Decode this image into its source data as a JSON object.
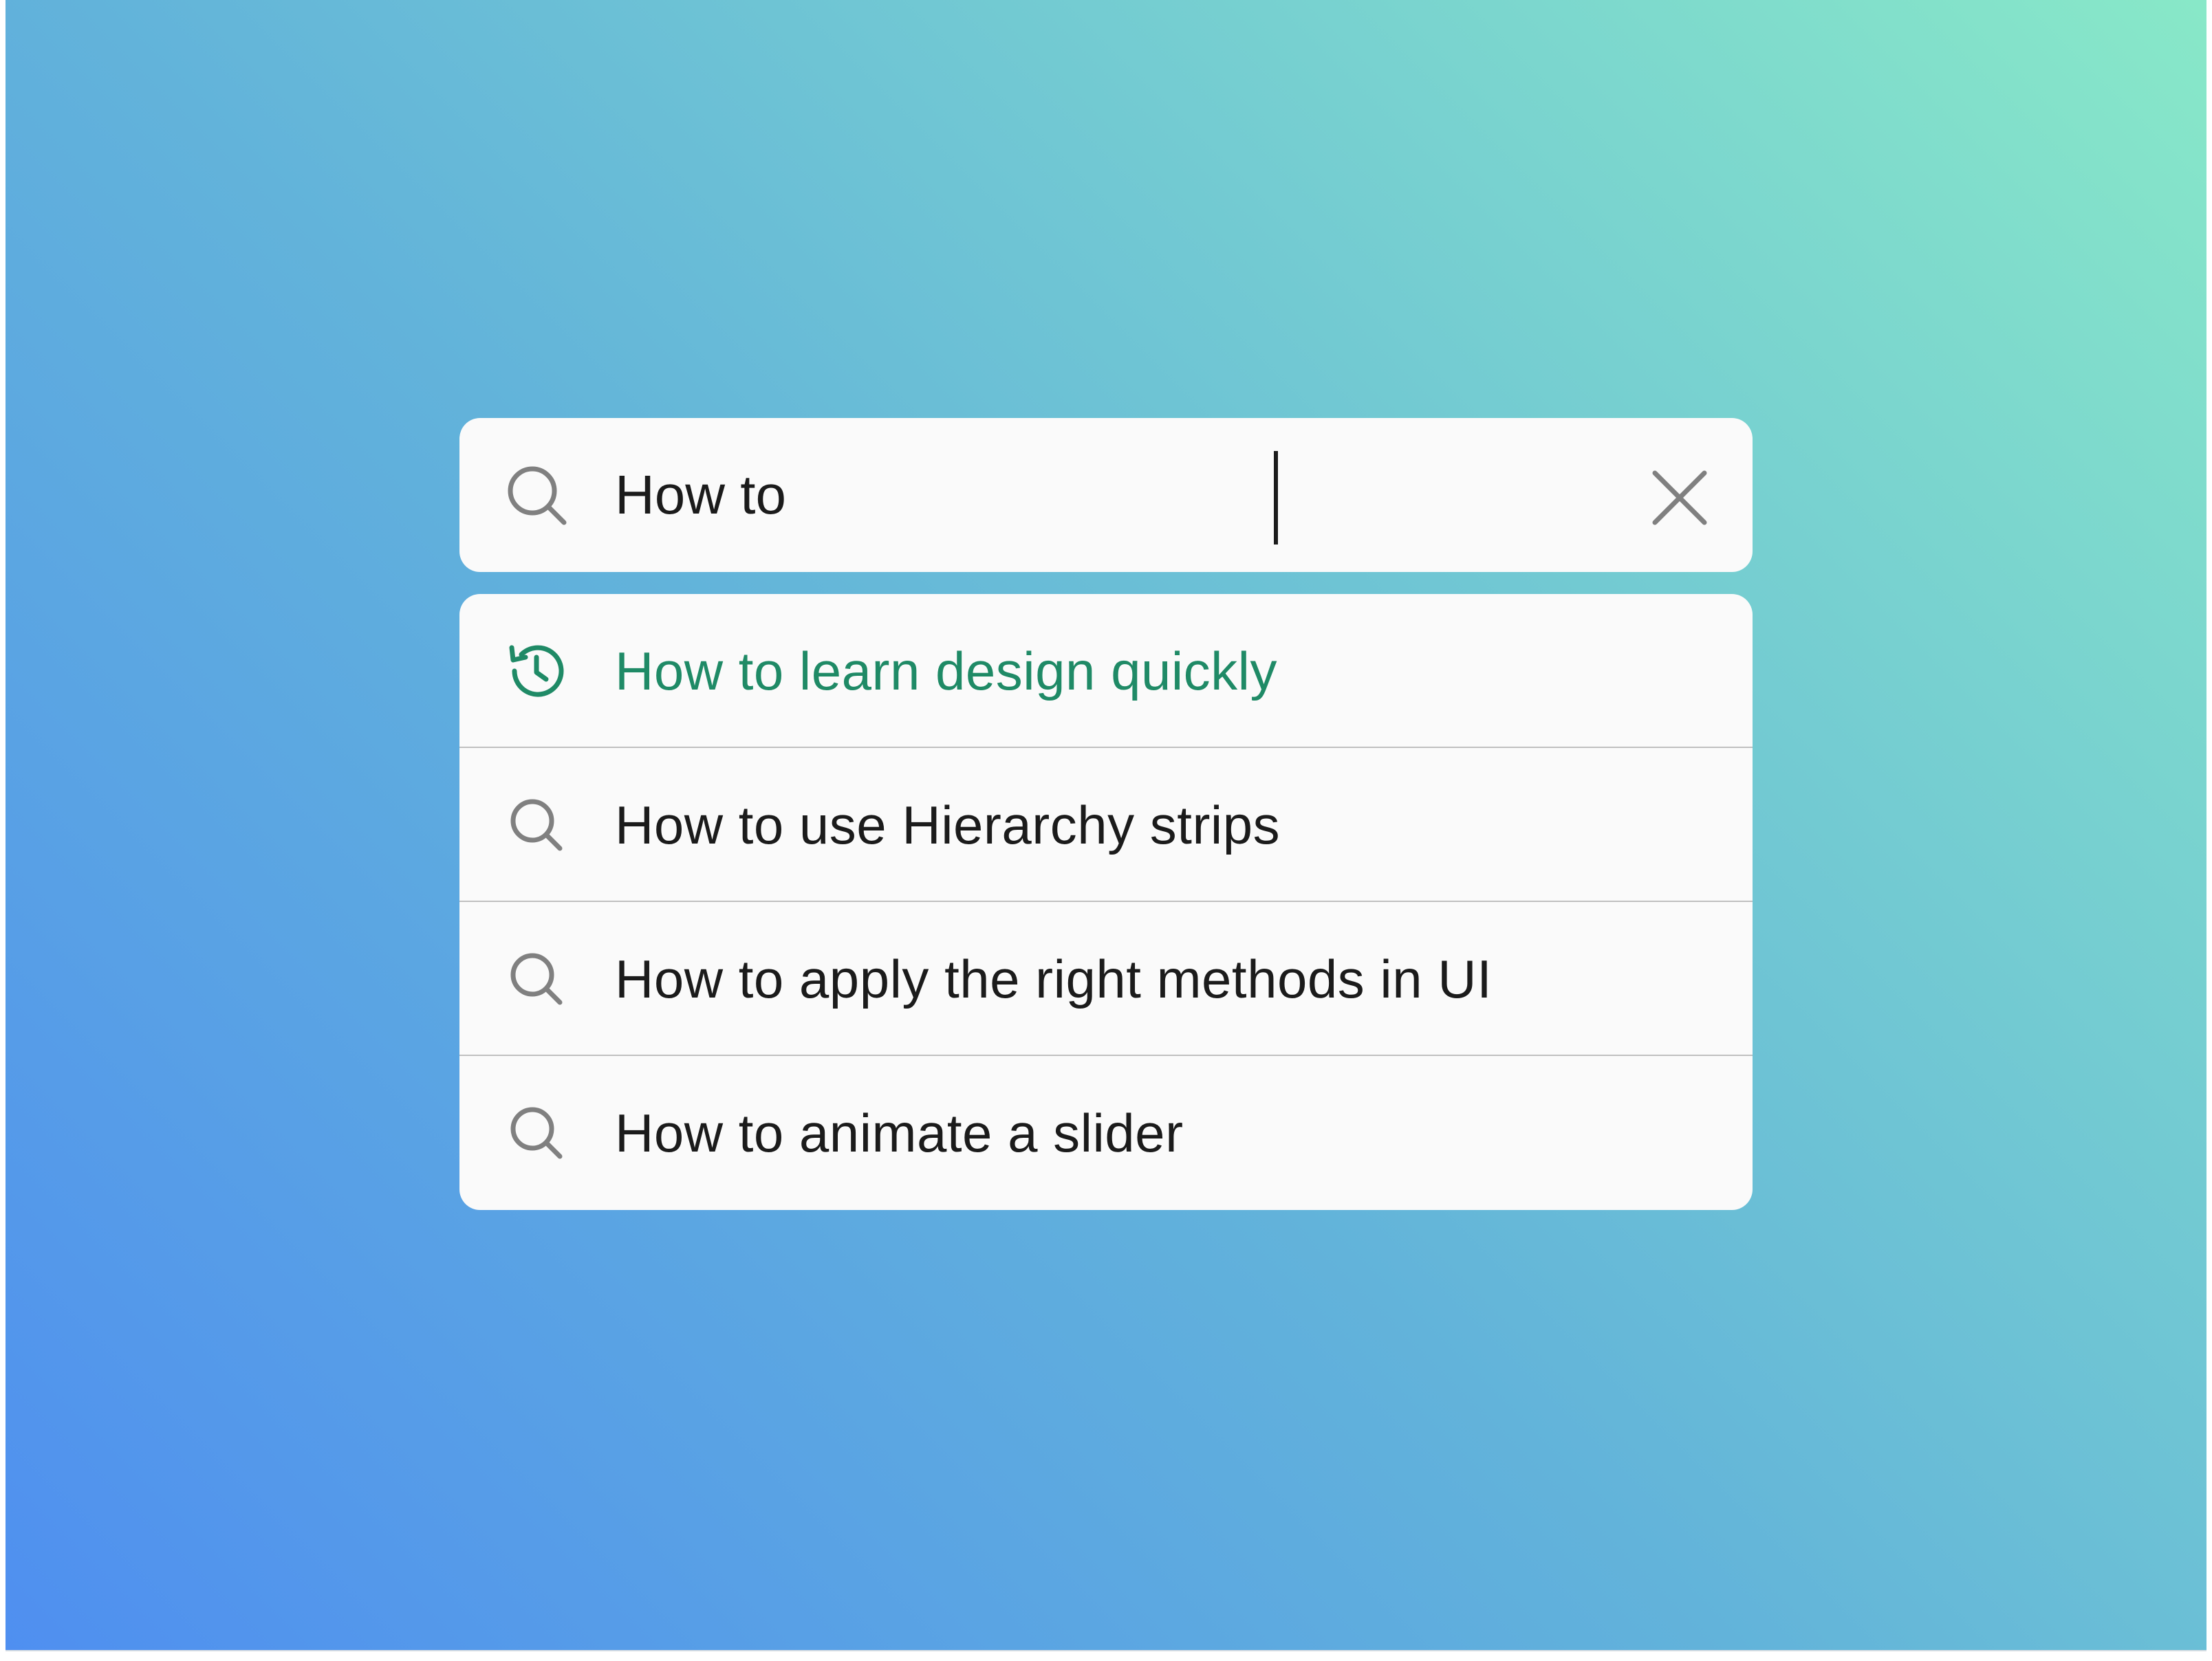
{
  "search": {
    "query": "How to",
    "icon": "search-icon",
    "clear_icon": "close-icon"
  },
  "suggestions": [
    {
      "label": "How to learn design quickly",
      "icon": "history-icon",
      "highlighted": true
    },
    {
      "label": "How to use Hierarchy strips",
      "icon": "search-icon",
      "highlighted": false
    },
    {
      "label": "How to apply the right methods in UI",
      "icon": "search-icon",
      "highlighted": false
    },
    {
      "label": "How to animate a slider",
      "icon": "search-icon",
      "highlighted": false
    }
  ],
  "colors": {
    "highlight": "#1f8a66",
    "text": "#1b1b1b",
    "icon": "#808080",
    "panel": "#fafafa"
  }
}
